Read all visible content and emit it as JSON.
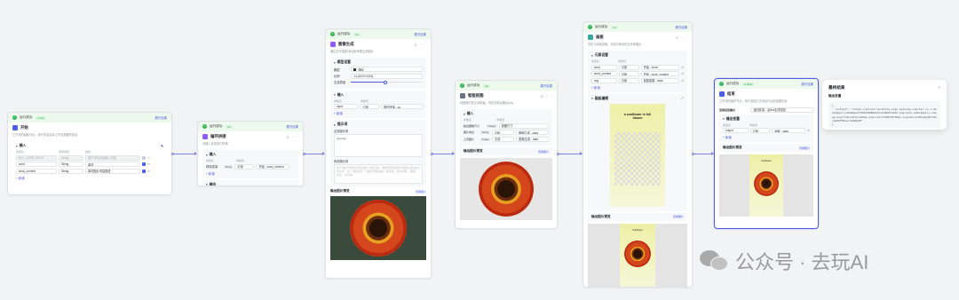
{
  "common": {
    "run_status": "运行成功",
    "view_result": "展开结果",
    "add": "+ 新增",
    "col_name": "变量名",
    "col_type": "变量类型",
    "col_value": "变量值",
    "col_param": "参数名",
    "col_param_value": "参数值",
    "ref": "引用",
    "output_preview": "输出图片预览",
    "open_image": "查看图片"
  },
  "start_node": {
    "time": "0.01s",
    "title": "开始",
    "desc": "工作流的起始节点，用于设定启动工作流需要的信息",
    "section": "输入",
    "rows": [
      {
        "name": "BOT_USER_INPUT",
        "type": "String",
        "desc": "用户本轮对话输入内容",
        "required": false
      },
      {
        "name": "word",
        "type": "String",
        "desc": "单词",
        "required": true
      },
      {
        "name": "word_content",
        "type": "String",
        "desc": "单词图片内容描述",
        "required": true
      }
    ]
  },
  "concat_node": {
    "time": "0s",
    "title": "循环拼接",
    "desc": "对输入变量进行拼接",
    "section": "输入",
    "row_name": "拼接变量",
    "row_type": "String",
    "row_value": "开始 - word_content",
    "output": "输出"
  },
  "imggen_node": {
    "time": "5s",
    "title": "图像生成",
    "desc": "通过文字描述/添加参考图生成图片",
    "model_section": "模型设置",
    "model_label": "模型",
    "model_value": "通用",
    "ratio_label": "比例",
    "ratio_value": "1:1(1024*1024)",
    "quality_label": "生成质量",
    "input_section": "输入",
    "input_name": "input",
    "input_value": "循环拼接 - ou",
    "prompt_section": "提示词",
    "positive_label": "正向提示词",
    "positive_placeholder": "{{input}}",
    "negative_label": "负向提示词",
    "negative_text": "用于描述不希望出现在图片中的元素，需要用到变量时可使用{{变量名}}的方式，如: 不要出现（人物的手部扭曲）等异常，低分辨率，模糊，文字，水印等",
    "preview_link": "查看图片"
  },
  "bgremove_node": {
    "time": "3s",
    "title": "智能抠图",
    "desc": "将图像中的主体保留，背景去除后输出png",
    "input_section": "输入",
    "rows": [
      {
        "name": "输出图像尺寸",
        "tag": "Integer",
        "mode": "",
        "value": "原图尺寸"
      },
      {
        "name": "图片地址",
        "tag": "String",
        "mode": "引用",
        "value": "图像生成 - data"
      },
      {
        "name": "上传图片",
        "tag": "Image",
        "mode": "引用",
        "value": "图像生成 - data"
      }
    ]
  },
  "canvas_node": {
    "time": "2s",
    "title": "画板",
    "desc": "自定义画板排版，支持引用添加文本和图片",
    "section": "元素设置",
    "rows": [
      {
        "name": "word",
        "mode": "引用",
        "value": "开始 - word"
      },
      {
        "name": "word_content",
        "mode": "引用",
        "value": "开始 - word_content"
      },
      {
        "name": "img",
        "mode": "引用",
        "value": "智能抠图 - data"
      }
    ],
    "board_section": "画板编辑",
    "poster_text": "a sunflower in full bloom",
    "poster_small": "Sunflower"
  },
  "end_node": {
    "time": "0.001s",
    "title": "结束",
    "desc": "工作流的最终节点，用于返回工作流运行后的结果信息",
    "mode_label": "选择回答模式",
    "mode_value": "返回变量，由Bot生成回答",
    "section": "输出变量",
    "row_name": "output",
    "row_mode": "引用",
    "row_value": "画板 - data"
  },
  "result_panel": {
    "title": "最终结果",
    "close": "×",
    "sub": "输出变量",
    "json": "{\n  \"output\": \"https://p3-bot-workflow-sign.byteimg.com/tos-cn-i-mdko3gqilj/abd0ebe3f45b45988b47ecbd9b0f2d43.png~tplv-mdko3gqilj-image.png?rk3s=c8fe7ad5&x-expires=1755878735&x-signature=6bnQ2jDFY4QjQvPAF8Zoyr%2bWGZE\"\n}"
  },
  "watermark": {
    "text": "公众号 · 去玩AI",
    "icon": "wechat-icon"
  },
  "colors": {
    "accent": "#4e5ee4",
    "success": "#2fb457",
    "edge": "#7b84e8"
  }
}
